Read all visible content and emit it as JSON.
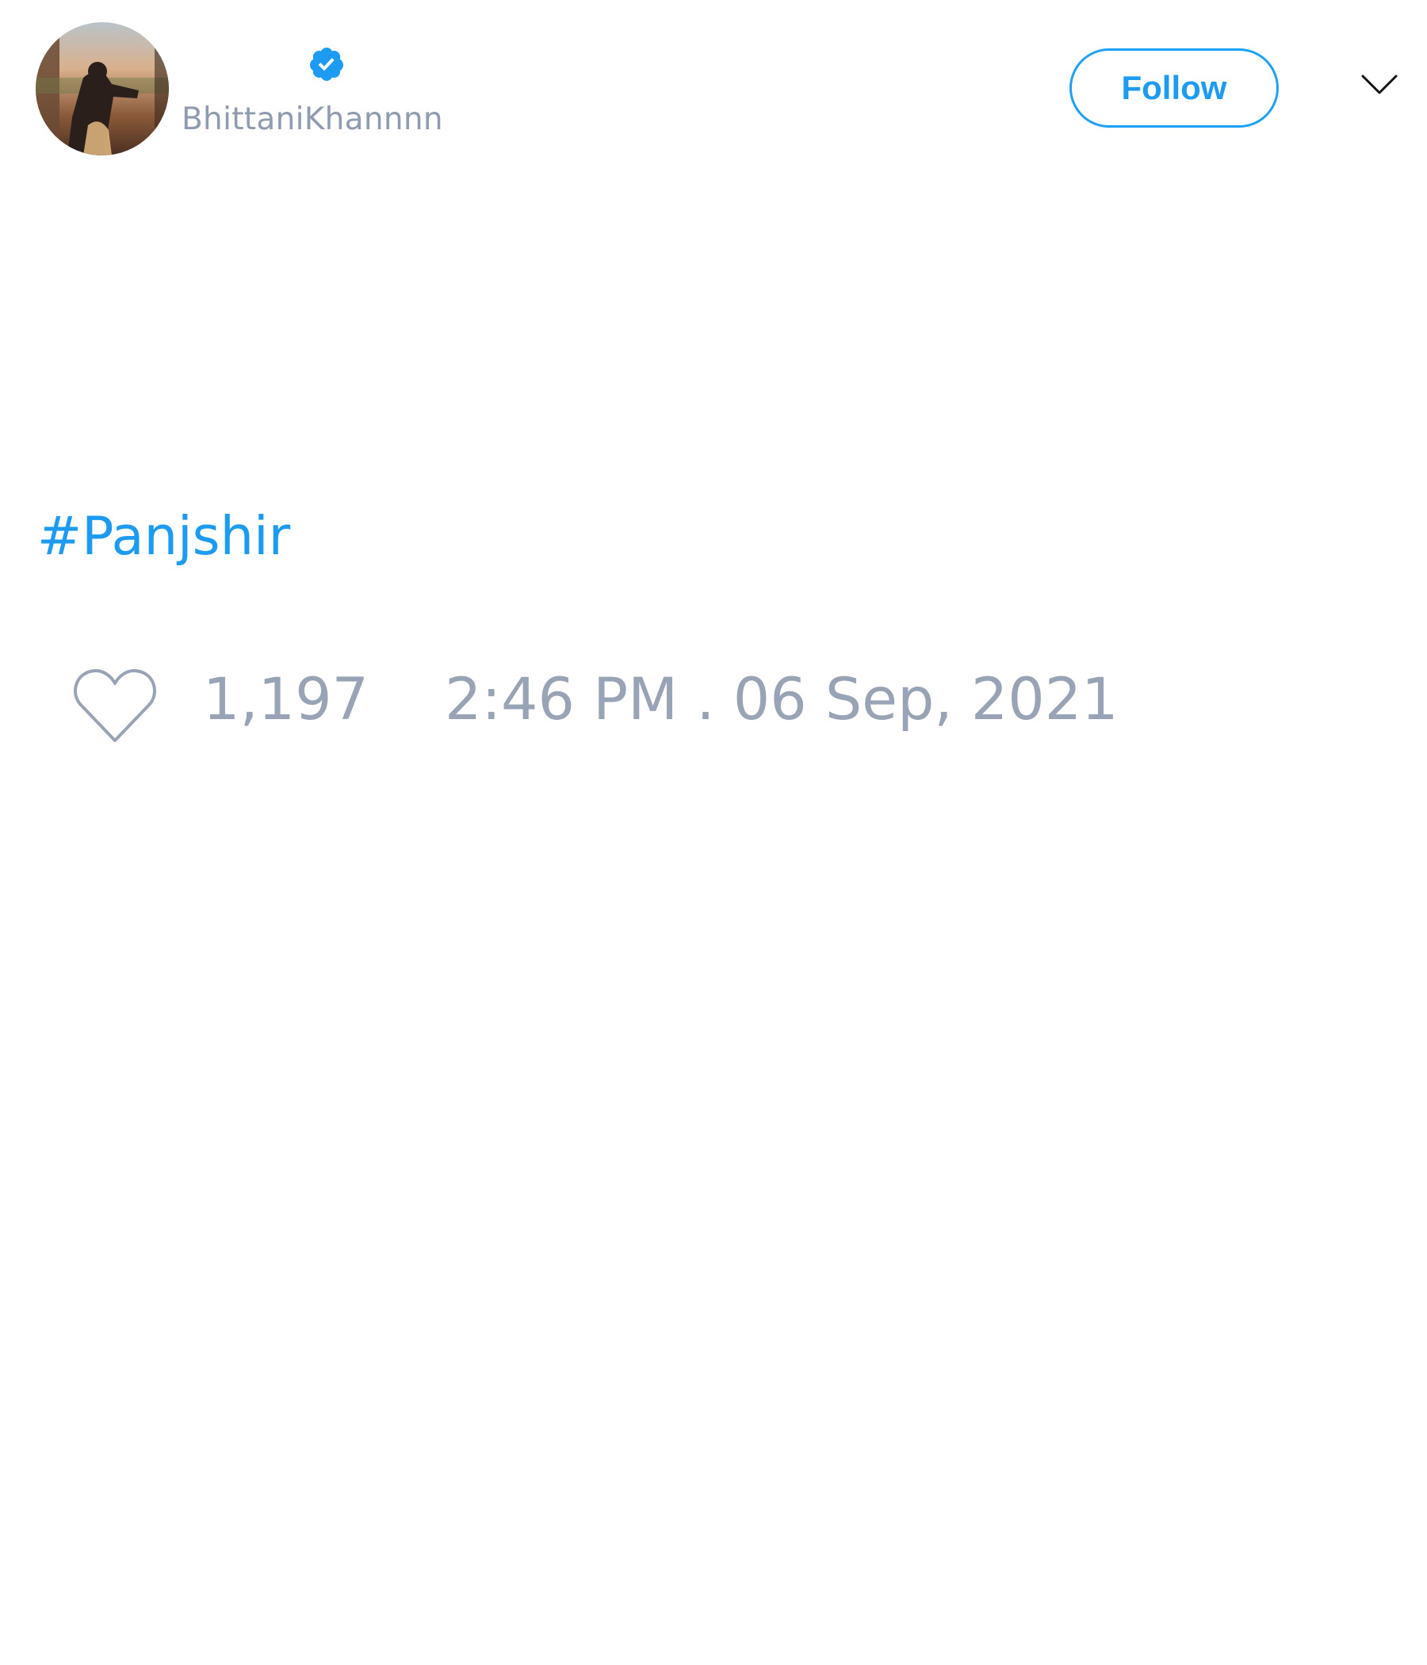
{
  "tweet": {
    "author": {
      "display_name": "",
      "handle": "BhittaniKhannnn",
      "verified": true,
      "avatar_icon": "avatar-photo"
    },
    "follow_label": "Follow",
    "menu_icon": "chevron-down-icon",
    "text": "#Panjshir",
    "like_icon": "heart-outline-icon",
    "like_count": "1,197",
    "timestamp": "2:46 PM . 06 Sep, 2021"
  },
  "colors": {
    "accent": "#1d9bf0",
    "muted_text": "#98a4b6",
    "background": "#ffffff"
  }
}
